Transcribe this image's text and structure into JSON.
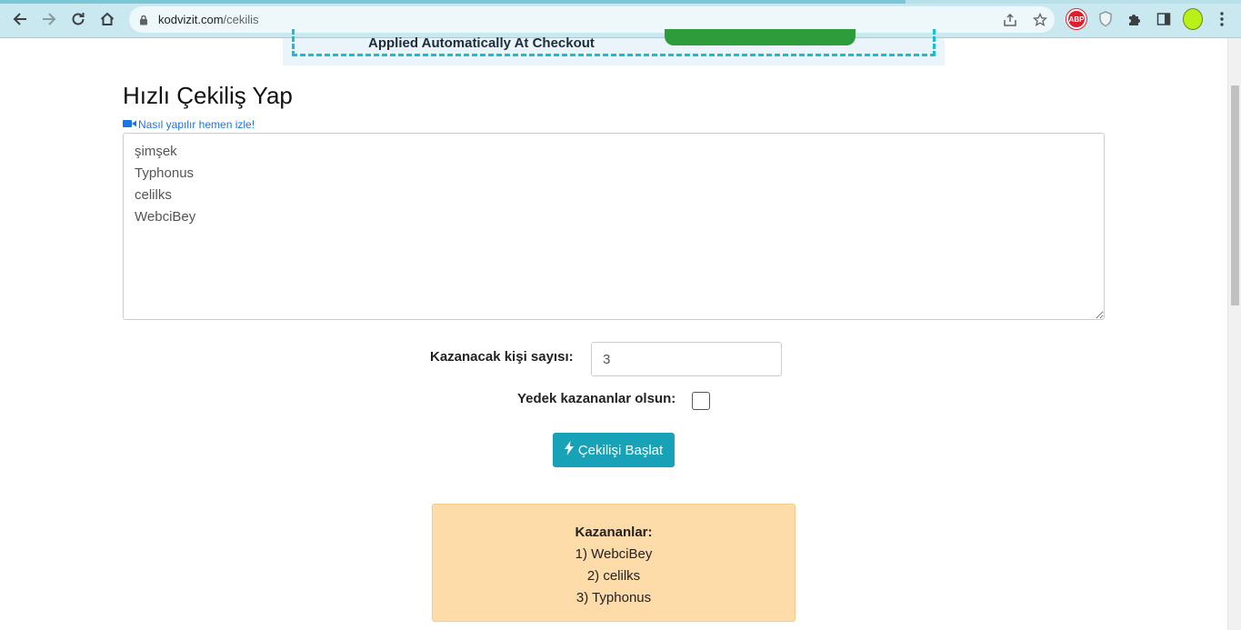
{
  "browser": {
    "url_domain": "kodvizit.com",
    "url_path": "/cekilis",
    "extensions": [
      "adblock-plus-icon",
      "shield-extension-icon",
      "puzzle-extensions-icon"
    ],
    "abp_label": "ABP"
  },
  "ad": {
    "text": "Applied Automatically At Checkout"
  },
  "page": {
    "title": "Hızlı Çekiliş Yap",
    "video_link": "Nasıl yapılır hemen izle!"
  },
  "names": {
    "value": "şimşek\nTyphonus\ncelilks\nWebciBey"
  },
  "form": {
    "winner_count_label": "Kazanacak kişi sayısı:",
    "winner_count_value": "3",
    "backup_label": "Yedek kazananlar olsun:",
    "backup_checked": false,
    "start_button": "Çekilişi Başlat"
  },
  "winners": {
    "title": "Kazananlar:",
    "items": [
      "1) WebciBey",
      "2) celilks",
      "3) Typhonus"
    ]
  },
  "colors": {
    "accent": "#17a2b8",
    "winners_bg": "#fddcaa",
    "link": "#1a73e8",
    "ad_border": "#14bfd6"
  }
}
